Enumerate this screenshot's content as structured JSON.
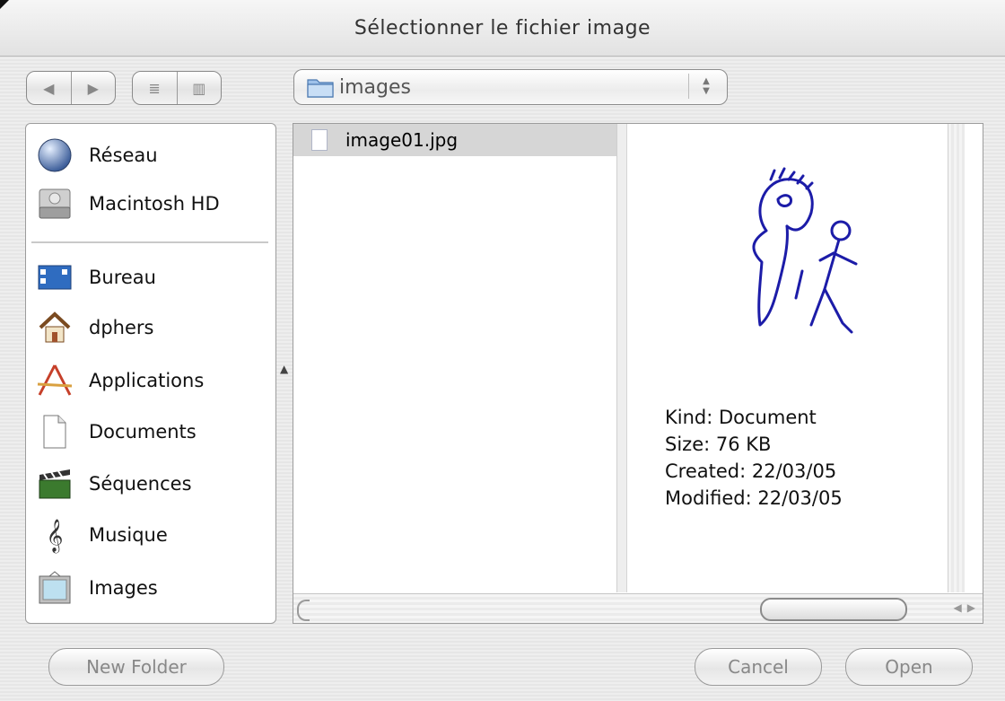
{
  "window": {
    "title": "Sélectionner le fichier image"
  },
  "toolbar": {
    "back_label": "◀",
    "forward_label": "▶",
    "list_view_label": "≣",
    "column_view_label": "▥",
    "location": "images"
  },
  "sidebar": {
    "devices": [
      {
        "label": "Réseau",
        "icon": "network-globe-icon"
      },
      {
        "label": "Macintosh HD",
        "icon": "hard-drive-icon"
      }
    ],
    "places": [
      {
        "label": "Bureau",
        "icon": "desktop-icon"
      },
      {
        "label": "dphers",
        "icon": "home-icon"
      },
      {
        "label": "Applications",
        "icon": "applications-icon"
      },
      {
        "label": "Documents",
        "icon": "document-icon"
      },
      {
        "label": "Séquences",
        "icon": "clapboard-icon"
      },
      {
        "label": "Musique",
        "icon": "music-clef-icon"
      },
      {
        "label": "Images",
        "icon": "picture-frame-icon"
      }
    ]
  },
  "browser": {
    "files": [
      {
        "name": "image01.jpg",
        "selected": true
      }
    ],
    "preview": {
      "kind": "Kind: Document",
      "size": "Size: 76 KB",
      "created": "Created: 22/03/05",
      "modified": "Modified: 22/03/05"
    }
  },
  "buttons": {
    "new_folder": "New Folder",
    "cancel": "Cancel",
    "open": "Open"
  },
  "colors": {
    "selection": "#d6d6d6",
    "drawing_ink": "#1c1ca8"
  }
}
